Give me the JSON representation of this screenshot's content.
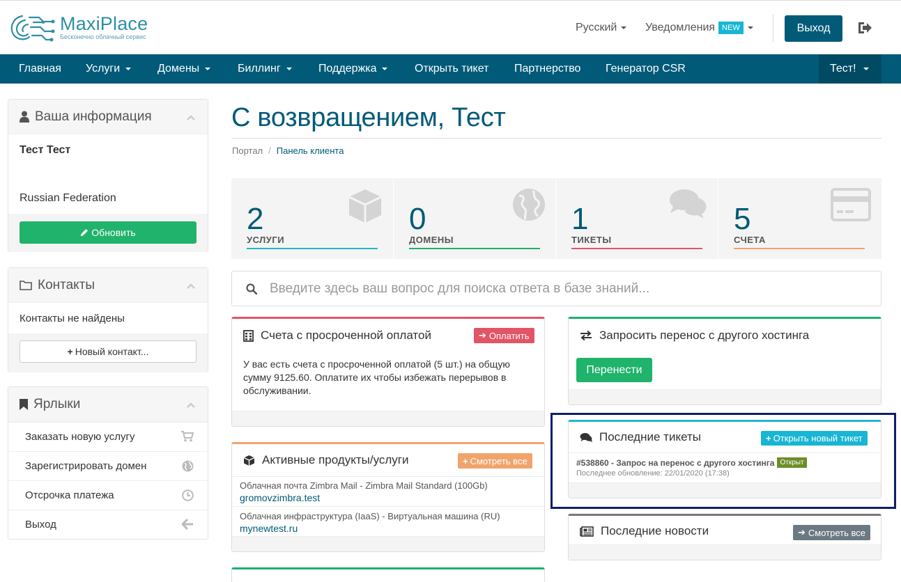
{
  "header": {
    "brand_name": "MaxiPlace",
    "brand_tagline": "Бесконечно облачный сервис",
    "language": "Русский",
    "notifications": "Уведомления",
    "new_badge": "New",
    "logout_button": "Выход"
  },
  "nav": {
    "items": [
      "Главная",
      "Услуги",
      "Домены",
      "Биллинг",
      "Поддержка",
      "Открыть тикет",
      "Партнерство",
      "Генератор CSR"
    ],
    "user": "Тест!"
  },
  "sidebar": {
    "info": {
      "title": "Ваша информация",
      "name": "Тест Тест",
      "country": "Russian Federation",
      "update_button": "Обновить"
    },
    "contacts": {
      "title": "Контакты",
      "empty": "Контакты не найдены",
      "new_button": "Новый контакт..."
    },
    "shortcuts": {
      "title": "Ярлыки",
      "items": [
        "Заказать новую услугу",
        "Зарегистрировать домен",
        "Отсрочка платежа",
        "Выход"
      ]
    }
  },
  "main": {
    "title": "С возвращением, Тест",
    "breadcrumb": [
      "Портал",
      "Панель клиента"
    ],
    "stats": [
      {
        "value": "2",
        "label": "УСЛУГИ",
        "color": "#21b5d0"
      },
      {
        "value": "0",
        "label": "ДОМЕНЫ",
        "color": "#1db06f"
      },
      {
        "value": "1",
        "label": "ТИКЕТЫ",
        "color": "#e25566"
      },
      {
        "value": "5",
        "label": "СЧЕТА",
        "color": "#f0a46c"
      }
    ],
    "search_placeholder": "Введите здесь ваш вопрос для поиска ответа в базе знаний...",
    "overdue": {
      "title": "Счета с просроченной оплатой",
      "pay_button": "Оплатить",
      "text": "У вас есть счета с просроченной оплатой (5 шт.) на общую сумму 9125.60. Оплатите их чтобы избежать перерывов в обслуживании."
    },
    "products": {
      "title": "Активные продукты/услуги",
      "view_all": "Смотреть все",
      "items": [
        {
          "name": "Облачная почта Zimbra Mail - Zimbra Mail Standard (100Gb)",
          "domain": "gromovzimbra.test"
        },
        {
          "name": "Облачная инфраструктура (IaaS) - Виртуальная машина (RU)",
          "domain": "mynewtest.ru"
        }
      ]
    },
    "transfer": {
      "title": "Запросить перенос с другого хостинга",
      "button": "Перенести"
    },
    "tickets": {
      "title": "Последние тикеты",
      "open_button": "Открыть новый тикет",
      "item_title": "#538860 - Запрос на перенос с другого хостинга",
      "status": "Открыт",
      "updated": "Последнее обновление: 22/01/2020 (17:38)"
    },
    "news": {
      "title": "Последние новости",
      "view_all": "Смотреть все"
    }
  }
}
